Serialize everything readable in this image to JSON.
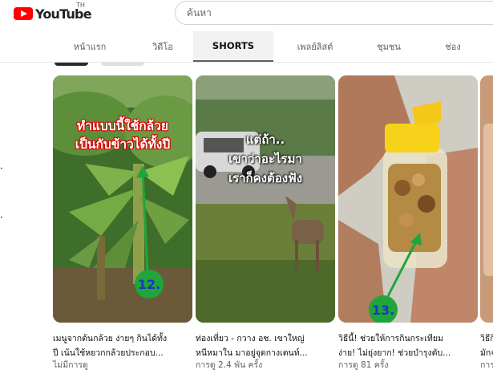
{
  "header": {
    "logo_text": "YouTube",
    "region": "TH",
    "search_placeholder": "ค้นหา"
  },
  "tabs": [
    {
      "label": "หน้าแรก",
      "active": false
    },
    {
      "label": "วิดีโอ",
      "active": false
    },
    {
      "label": "SHORTS",
      "active": true
    },
    {
      "label": "เพลย์ลิสต์",
      "active": false
    },
    {
      "label": "ชุมชน",
      "active": false
    },
    {
      "label": "ช่อง",
      "active": false
    }
  ],
  "cards": [
    {
      "overlay_line1": "ทำแบบนี้ใช้กล้วย",
      "overlay_line2": "เป็นกับข้าวได้ทั้งปี",
      "badge": "12.",
      "title_line1": "เมนูจากต้นกล้วย ง่ายๆ กินได้ทั้ง",
      "title_line2": "ปี เน้นใช้หยวกกล้วยประกอบ...",
      "views": "ไม่มีการดู"
    },
    {
      "overlay_line1": "แต่ถ้า..",
      "overlay_line2": "เขาว่าอะไรมา",
      "overlay_line3": "เราก็คงต้องฟัง",
      "title_line1": "ท่องเที่ยว - กวาง อช. เขาใหญ่",
      "title_line2": "หนีหมาใน มาอยู่จุดกางเตนท์...",
      "views": "การดู 2.4 พัน ครั้ง"
    },
    {
      "badge": "13.",
      "title_line1": "วิธีนี้! ช่วยให้การกินกระเทียม",
      "title_line2": "ง่าย! ไม่ยุ่งยาก! ช่วยบำรุงตับ...",
      "views": "การดู 81 ครั้ง"
    },
    {
      "title_line1": "วิธีกิ",
      "title_line2": "มักจ",
      "views": "การดู"
    }
  ],
  "colors": {
    "brand_red": "#ff0000",
    "annotation_green": "#1fa53a",
    "annotation_number": "#1a35c8"
  }
}
